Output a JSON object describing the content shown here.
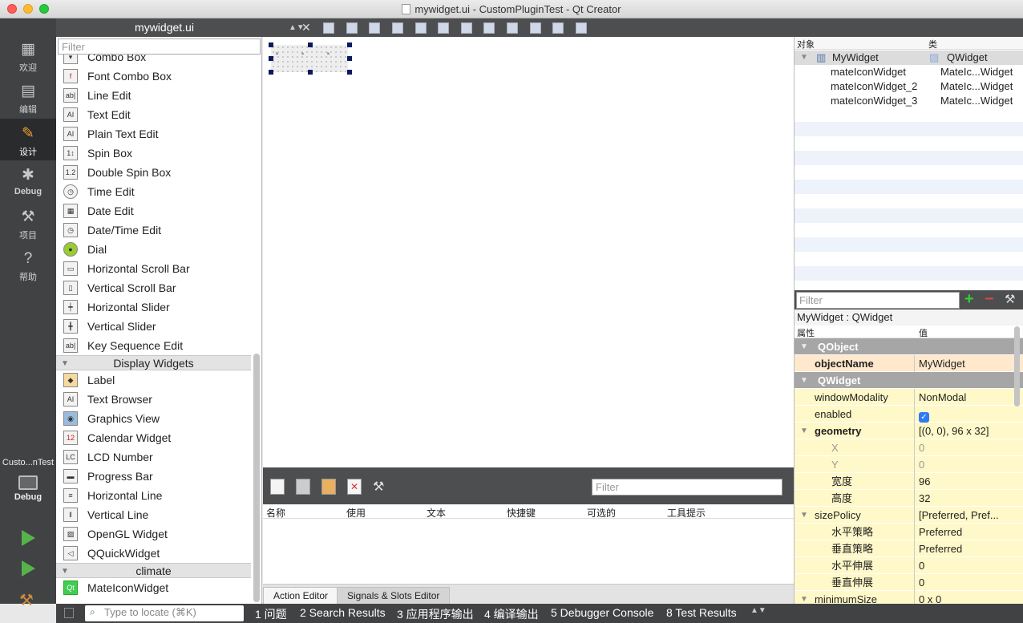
{
  "window": {
    "title": "mywidget.ui - CustomPluginTest - Qt Creator"
  },
  "modes": [
    {
      "label": "欢迎",
      "icon": "grid-icon"
    },
    {
      "label": "编辑",
      "icon": "document-icon"
    },
    {
      "label": "设计",
      "icon": "pencil-icon",
      "active": true
    },
    {
      "label": "Debug",
      "icon": "bug-icon"
    },
    {
      "label": "项目",
      "icon": "wrench-icon"
    },
    {
      "label": "帮助",
      "icon": "help-icon"
    }
  ],
  "kit": {
    "project": "Custo...nTest",
    "config": "Debug"
  },
  "editor": {
    "file_tab": "mywidget.ui"
  },
  "widgetbox": {
    "filter_placeholder": "Filter",
    "items": [
      {
        "label": "Combo Box",
        "icon": "combo-box-icon"
      },
      {
        "label": "Font Combo Box",
        "icon": "font-combo-icon"
      },
      {
        "label": "Line Edit",
        "icon": "line-edit-icon"
      },
      {
        "label": "Text Edit",
        "icon": "text-edit-icon"
      },
      {
        "label": "Plain Text Edit",
        "icon": "plain-text-edit-icon"
      },
      {
        "label": "Spin Box",
        "icon": "spin-box-icon"
      },
      {
        "label": "Double Spin Box",
        "icon": "double-spin-box-icon"
      },
      {
        "label": "Time Edit",
        "icon": "clock-icon"
      },
      {
        "label": "Date Edit",
        "icon": "calendar-icon"
      },
      {
        "label": "Date/Time Edit",
        "icon": "datetime-icon"
      },
      {
        "label": "Dial",
        "icon": "dial-icon"
      },
      {
        "label": "Horizontal Scroll Bar",
        "icon": "hscrollbar-icon"
      },
      {
        "label": "Vertical Scroll Bar",
        "icon": "vscrollbar-icon"
      },
      {
        "label": "Horizontal Slider",
        "icon": "hslider-icon"
      },
      {
        "label": "Vertical Slider",
        "icon": "vslider-icon"
      },
      {
        "label": "Key Sequence Edit",
        "icon": "key-sequence-icon"
      }
    ],
    "category_display": "Display Widgets",
    "display_items": [
      {
        "label": "Label",
        "icon": "label-icon"
      },
      {
        "label": "Text Browser",
        "icon": "text-browser-icon"
      },
      {
        "label": "Graphics View",
        "icon": "graphics-view-icon"
      },
      {
        "label": "Calendar Widget",
        "icon": "calendar-widget-icon"
      },
      {
        "label": "LCD Number",
        "icon": "lcd-icon"
      },
      {
        "label": "Progress Bar",
        "icon": "progress-bar-icon"
      },
      {
        "label": "Horizontal Line",
        "icon": "hline-icon"
      },
      {
        "label": "Vertical Line",
        "icon": "vline-icon"
      },
      {
        "label": "OpenGL Widget",
        "icon": "opengl-icon"
      },
      {
        "label": "QQuickWidget",
        "icon": "qquick-icon"
      }
    ],
    "category_climate": "climate",
    "climate_items": [
      {
        "label": "MateIconWidget",
        "icon": "qt-icon"
      }
    ]
  },
  "action_editor": {
    "filter_placeholder": "Filter",
    "columns": [
      "名称",
      "使用",
      "文本",
      "快捷键",
      "可选的",
      "工具提示"
    ],
    "tabs": [
      "Action Editor",
      "Signals & Slots Editor"
    ]
  },
  "object_inspector": {
    "columns": [
      "对象",
      "类"
    ],
    "rows": [
      {
        "object": "MyWidget",
        "class": "QWidget"
      },
      {
        "object": "mateIconWidget",
        "class": "MateIc...Widget"
      },
      {
        "object": "mateIconWidget_2",
        "class": "MateIc...Widget"
      },
      {
        "object": "mateIconWidget_3",
        "class": "MateIc...Widget"
      }
    ]
  },
  "property_editor": {
    "filter_placeholder": "Filter",
    "class_label": "MyWidget : QWidget",
    "columns": [
      "属性",
      "值"
    ],
    "rows": [
      {
        "type": "group",
        "name": "QObject"
      },
      {
        "type": "prop",
        "name": "objectName",
        "value": "MyWidget",
        "style": "orange bold"
      },
      {
        "type": "group",
        "name": "QWidget"
      },
      {
        "type": "prop",
        "name": "windowModality",
        "value": "NonModal",
        "style": "yellow"
      },
      {
        "type": "check",
        "name": "enabled",
        "value": "✓",
        "style": "yellow"
      },
      {
        "type": "expand",
        "name": "geometry",
        "value": "[(0, 0), 96 x 32]",
        "style": "yellow bold"
      },
      {
        "type": "sub",
        "name": "X",
        "value": "0",
        "style": "yellow dis"
      },
      {
        "type": "sub",
        "name": "Y",
        "value": "0",
        "style": "yellow dis"
      },
      {
        "type": "sub",
        "name": "宽度",
        "value": "96",
        "style": "yellow"
      },
      {
        "type": "sub",
        "name": "高度",
        "value": "32",
        "style": "yellow"
      },
      {
        "type": "expand",
        "name": "sizePolicy",
        "value": "[Preferred, Pref...",
        "style": "yellow"
      },
      {
        "type": "sub",
        "name": "水平策略",
        "value": "Preferred",
        "style": "yellow"
      },
      {
        "type": "sub",
        "name": "垂直策略",
        "value": "Preferred",
        "style": "yellow"
      },
      {
        "type": "sub",
        "name": "水平伸展",
        "value": "0",
        "style": "yellow"
      },
      {
        "type": "sub",
        "name": "垂直伸展",
        "value": "0",
        "style": "yellow"
      },
      {
        "type": "expand",
        "name": "minimumSize",
        "value": "0 x 0",
        "style": "yellow"
      }
    ]
  },
  "statusbar": {
    "locate_placeholder": "Type to locate (⌘K)",
    "panes": [
      "1 问题",
      "2 Search Results",
      "3 应用程序输出",
      "4 编译输出",
      "5 Debugger Console",
      "8 Test Results"
    ]
  }
}
